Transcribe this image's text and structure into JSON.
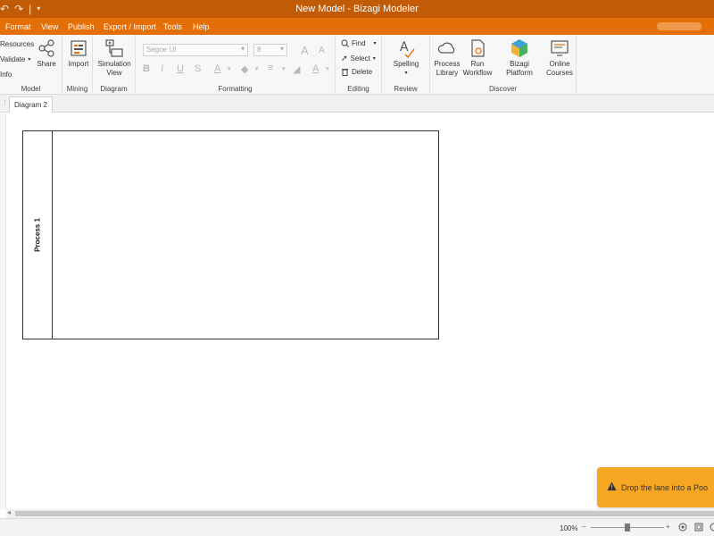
{
  "window": {
    "title": "New Model - Bizagi Modeler"
  },
  "menu": {
    "items": [
      "Format",
      "View",
      "Publish",
      "Export / Import",
      "Tools",
      "Help"
    ]
  },
  "ribbon": {
    "model": {
      "resources": "Resources",
      "validate": "Validate",
      "info": "Info",
      "share": "Share",
      "label": "Model"
    },
    "mining": {
      "import": "Import",
      "label": "Mining"
    },
    "diagram": {
      "simulation": "Simulation View",
      "label": "Diagram"
    },
    "formatting": {
      "font": "Segoe UI",
      "size": "8",
      "label": "Formatting"
    },
    "editing": {
      "find": "Find",
      "select": "Select",
      "delete": "Delete",
      "label": "Editing"
    },
    "review": {
      "spelling": "Spelling",
      "label": "Review"
    },
    "discover": {
      "process_library": "Process Library",
      "run_workflow": "Run Workflow",
      "bizagi_platform": "Bizagi Platform",
      "online_courses": "Online Courses",
      "label": "Discover"
    }
  },
  "tabs": {
    "active": "Diagram 2"
  },
  "canvas": {
    "pool_name": "Process 1"
  },
  "toast": {
    "message": "Drop the lane into a Poo"
  },
  "status": {
    "zoom": "100%"
  },
  "colors": {
    "titlebar": "#c25b05",
    "menubar": "#e36f06",
    "toast": "#f6a623"
  }
}
